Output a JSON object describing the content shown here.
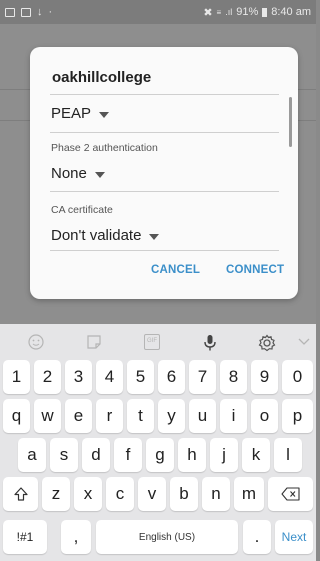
{
  "status_bar": {
    "battery": "91%",
    "time": "8:40 am"
  },
  "dialog": {
    "title": "oakhillcollege",
    "eap_method": "PEAP",
    "phase2_label": "Phase 2 authentication",
    "phase2_value": "None",
    "ca_label": "CA certificate",
    "ca_value": "Don't validate",
    "cancel": "CANCEL",
    "connect": "CONNECT"
  },
  "keyboard": {
    "toolbar_icons": [
      "emoji-icon",
      "sticker-icon",
      "gif-icon",
      "microphone-icon",
      "settings-icon",
      "collapse-icon"
    ],
    "gif_label": "GIF",
    "row_numbers": [
      "1",
      "2",
      "3",
      "4",
      "5",
      "6",
      "7",
      "8",
      "9",
      "0"
    ],
    "row_q": [
      "q",
      "w",
      "e",
      "r",
      "t",
      "y",
      "u",
      "i",
      "o",
      "p"
    ],
    "row_a": [
      "a",
      "s",
      "d",
      "f",
      "g",
      "h",
      "j",
      "k",
      "l"
    ],
    "row_z": [
      "z",
      "x",
      "c",
      "v",
      "b",
      "n",
      "m"
    ],
    "symbols_key": "!#1",
    "comma_key": ",",
    "space_key": "English (US)",
    "period_key": ".",
    "next_key": "Next"
  },
  "colors": {
    "accent": "#3b8fc9",
    "keyboard_bg": "#e5e5e7",
    "dim_bg": "#8a8a8a"
  }
}
